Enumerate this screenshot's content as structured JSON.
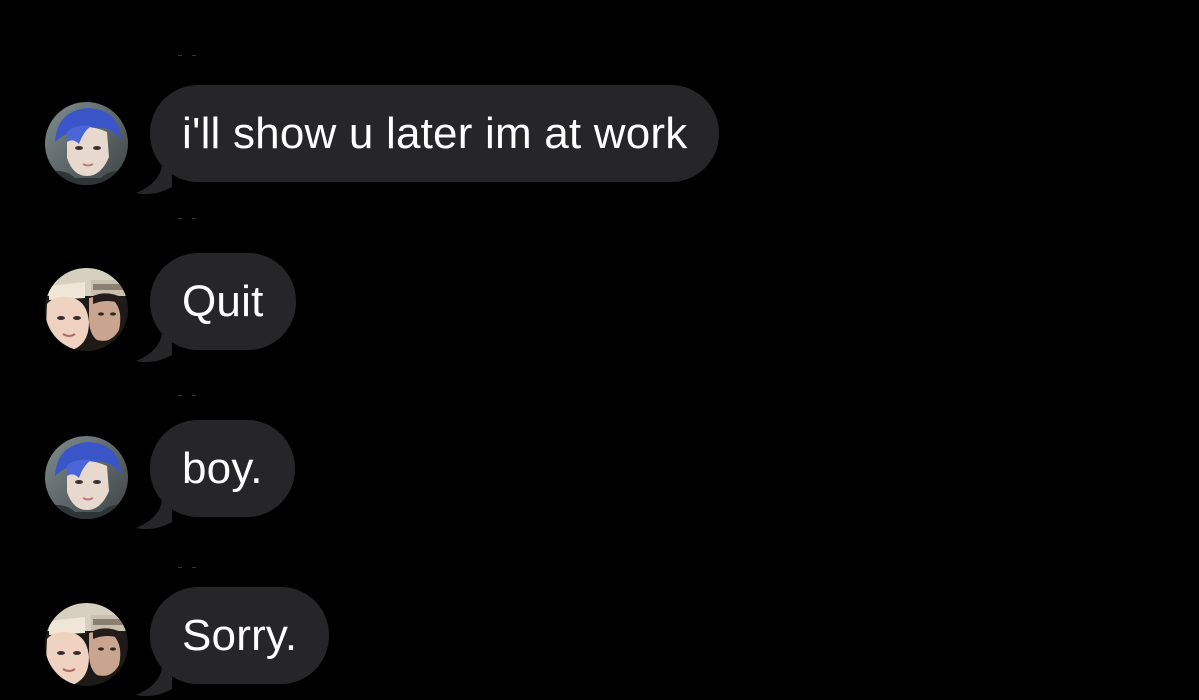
{
  "messages": [
    {
      "avatar": "blue-haired-profile-photo",
      "text": "i'll show u later im at work"
    },
    {
      "avatar": "two-person-selfie-photo",
      "text": "Quit"
    },
    {
      "avatar": "blue-haired-profile-photo",
      "text": "boy."
    },
    {
      "avatar": "two-person-selfie-photo",
      "text": "Sorry."
    }
  ],
  "colors": {
    "background": "#000000",
    "bubble": "#262628",
    "text": "#ffffff"
  }
}
